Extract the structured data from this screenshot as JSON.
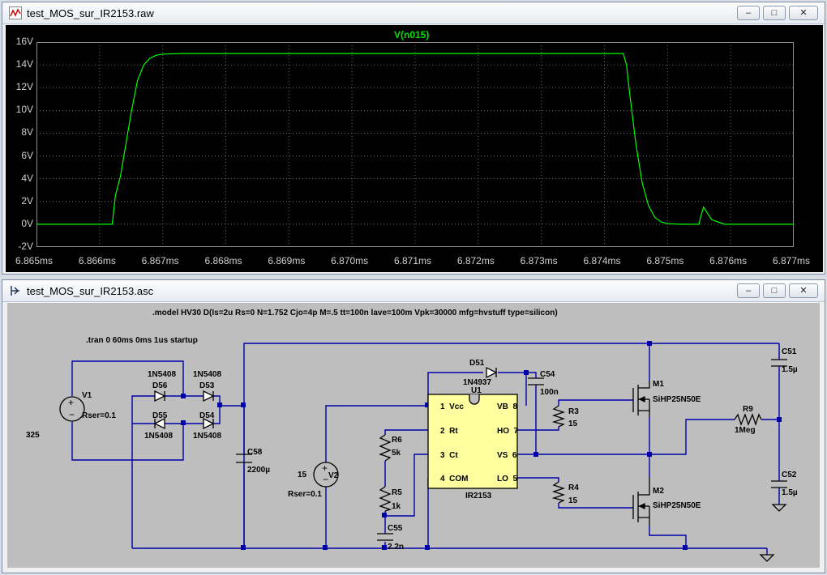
{
  "waveform_window": {
    "title": "test_MOS_sur_IR2153.raw",
    "trace_label": "V(n015)",
    "trace_color": "#00ff00",
    "controls": {
      "minimize": "–",
      "maximize": "□",
      "close": "✕"
    }
  },
  "schematic_window": {
    "title": "test_MOS_sur_IR2153.asc",
    "controls": {
      "minimize": "–",
      "maximize": "□",
      "close": "✕"
    },
    "directives": {
      "model": ".model HV30 D(Is=2u Rs=0 N=1.752 Cjo=4p M=.5 tt=100n lave=100m Vpk=30000 mfg=hvstuff type=silicon)",
      "tran": ".tran 0 60ms 0ms 1us startup"
    },
    "components": {
      "v1": {
        "name": "V1",
        "rser": "Rser=0.1",
        "value": "325"
      },
      "d56": {
        "name": "D56",
        "part": "1N5408"
      },
      "d53": {
        "name": "D53",
        "part": "1N5408"
      },
      "d55": {
        "name": "D55",
        "part": "1N5408"
      },
      "d54": {
        "name": "D54",
        "part": "1N5408"
      },
      "c58": {
        "name": "C58",
        "value": "2200µ"
      },
      "v2": {
        "name": "V2",
        "value": "15",
        "rser": "Rser=0.1"
      },
      "r6": {
        "name": "R6",
        "value": "5k"
      },
      "r5": {
        "name": "R5",
        "value": "1k"
      },
      "c55": {
        "name": "C55",
        "value": "2.2n"
      },
      "d51": {
        "name": "D51",
        "part": "1N4937"
      },
      "c54": {
        "name": "C54",
        "value": "100n"
      },
      "u1": {
        "name": "U1",
        "part": "IR2153",
        "pins": [
          "1  Vcc",
          "2  Rt",
          "3  Ct",
          "4  COM",
          "VB  8",
          "HO  7",
          "VS  6",
          "LO  5"
        ]
      },
      "r3": {
        "name": "R3",
        "value": "15"
      },
      "r4": {
        "name": "R4",
        "value": "15"
      },
      "m1": {
        "name": "M1",
        "part": "SiHP25N50E"
      },
      "m2": {
        "name": "M2",
        "part": "SiHP25N50E"
      },
      "r9": {
        "name": "R9",
        "value": "1Meg"
      },
      "c51": {
        "name": "C51",
        "value": "1.5µ"
      },
      "c52": {
        "name": "C52",
        "value": "1.5µ"
      }
    }
  },
  "chart_data": {
    "type": "line",
    "title": "V(n015)",
    "xlabel": "",
    "ylabel": "",
    "x_tick_labels": [
      "6.865ms",
      "6.866ms",
      "6.867ms",
      "6.868ms",
      "6.869ms",
      "6.870ms",
      "6.871ms",
      "6.872ms",
      "6.873ms",
      "6.874ms",
      "6.875ms",
      "6.876ms",
      "6.877ms"
    ],
    "y_tick_labels": [
      "16V",
      "14V",
      "12V",
      "10V",
      "8V",
      "6V",
      "4V",
      "2V",
      "0V",
      "-2V"
    ],
    "xlim": [
      6.865,
      6.877
    ],
    "ylim": [
      -2,
      16
    ],
    "grid": true,
    "series": [
      {
        "name": "V(n015)",
        "color": "#00ff00",
        "x": [
          6.865,
          6.8662,
          6.86625,
          6.8663,
          6.86633,
          6.8664,
          6.8665,
          6.8666,
          6.8667,
          6.8668,
          6.8669,
          6.867,
          6.8673,
          6.8743,
          6.87435,
          6.8744,
          6.8745,
          6.8746,
          6.8747,
          6.8748,
          6.8749,
          6.875,
          6.8752,
          6.8755,
          6.87552,
          6.87557,
          6.8757,
          6.8759,
          6.877
        ],
        "y": [
          0,
          0,
          2.5,
          3.6,
          4.2,
          6.5,
          9.8,
          12.6,
          14.0,
          14.6,
          14.85,
          14.95,
          15,
          15,
          14.0,
          11.5,
          7.0,
          3.6,
          1.6,
          0.6,
          0.2,
          0.05,
          0,
          0,
          0.55,
          1.5,
          0.4,
          0,
          0
        ]
      }
    ]
  }
}
